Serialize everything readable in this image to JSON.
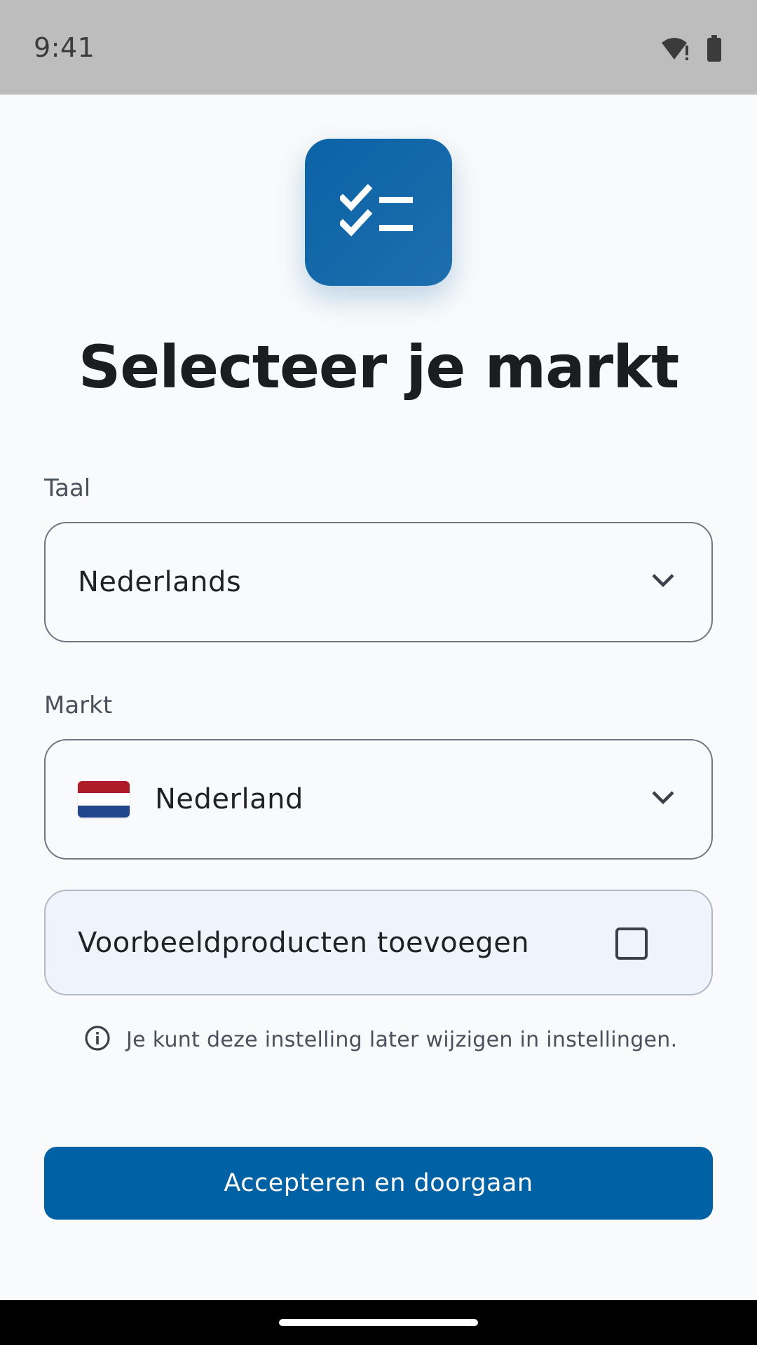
{
  "status_bar": {
    "time": "9:41",
    "icons": [
      "wifi-alert-icon",
      "battery-icon"
    ]
  },
  "app": {
    "logo_icon": "checklist-icon",
    "brand_color": "#0061a4"
  },
  "title": "Selecteer je markt",
  "language_field": {
    "label": "Taal",
    "value": "Nederlands",
    "icon": "chevron-down-icon"
  },
  "market_field": {
    "label": "Markt",
    "value": "Nederland",
    "flag_icon": "netherlands-flag-icon",
    "flag_colors": [
      "#ae1c28",
      "#ffffff",
      "#21468b"
    ],
    "icon": "chevron-down-icon"
  },
  "sample_products": {
    "label": "Voorbeeldproducten toevoegen",
    "checked": false
  },
  "info": {
    "icon": "info-icon",
    "text": "Je kunt deze instelling later wijzigen in instellingen."
  },
  "primary_button": {
    "label": "Accepteren en doorgaan"
  }
}
